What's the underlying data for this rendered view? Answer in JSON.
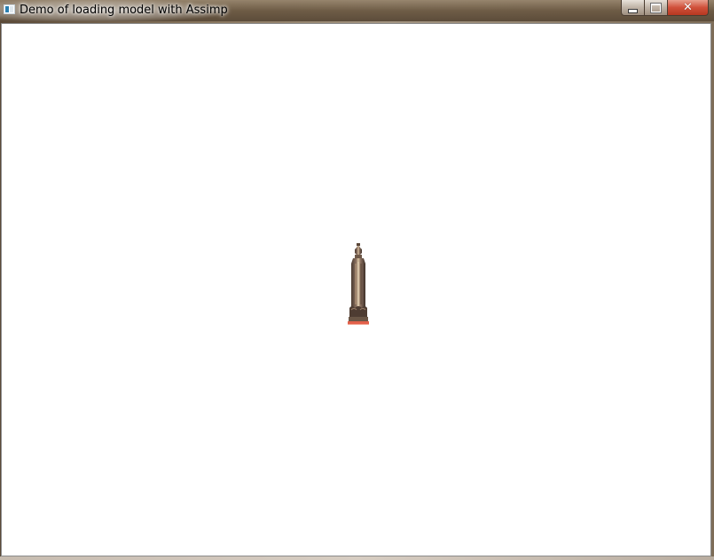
{
  "window": {
    "title": "Demo of loading model with Assimp"
  },
  "controls": {
    "minimize_icon": "minimize-icon",
    "maximize_icon": "maximize-icon",
    "close_icon": "close-icon",
    "close_glyph": "✕"
  },
  "viewport": {
    "background": "#ffffff",
    "model_description_icon": "statue-model"
  }
}
